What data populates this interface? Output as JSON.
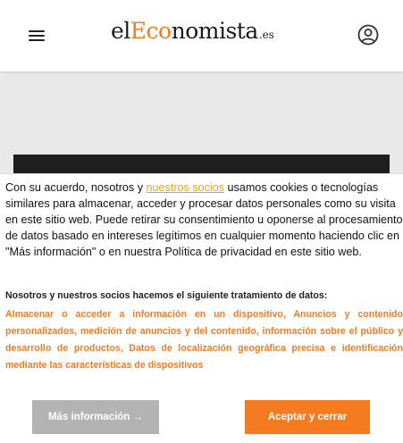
{
  "header": {
    "logo": {
      "part1": "el",
      "part2": "Eco",
      "part3": "nomista",
      "part4": ".es"
    },
    "menu_icon": "hamburger-menu-icon",
    "account_icon": "user-circle-icon"
  },
  "consent": {
    "intro_before_link": "Con su acuerdo, nosotros y ",
    "partners_link": "nuestros socios",
    "intro_after_link": " usamos cookies o tecnologías similares para almacenar, acceder y procesar datos personales como su visita en este sitio web. Puede retirar su consentimiento u oponerse al procesamiento de datos basado en intereses legítimos en cualquier momento haciendo clic en \"Más información\" o en nuestra Política de privacidad en este sitio web.",
    "processing_heading": "Nosotros y nuestros socios hacemos el siguiente tratamiento de datos:",
    "purposes": "Almacenar o acceder a información en un dispositivo, Anuncios y contenido personalizados, medición de anuncios y del contenido, información sobre el público y desarrollo de productos, Datos de localización geográfica precisa e identificación mediante las características de dispositivos",
    "more_info_label": "Más información →",
    "accept_label": "Aceptar y cerrar"
  },
  "colors": {
    "accent": "#f47b20",
    "link": "#f5a300",
    "secondary_button": "#b3b3b3",
    "background": "#e9e9e9"
  }
}
